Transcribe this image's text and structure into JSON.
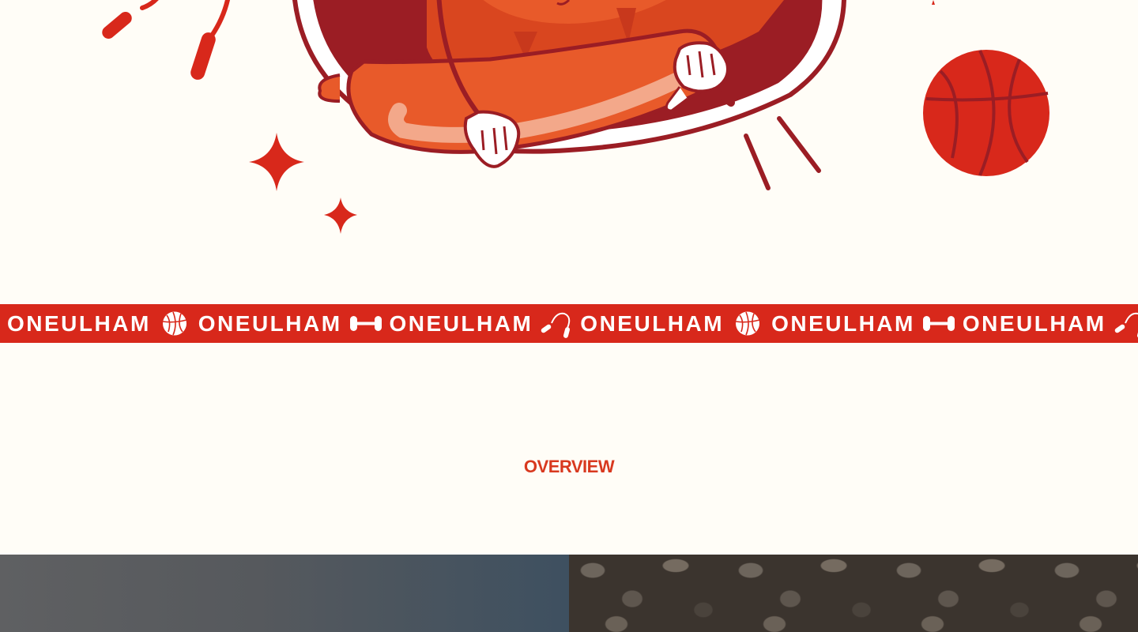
{
  "hero": {
    "illustration": "hotdog-mascot-illustration",
    "decorations": [
      "jump-rope-icon",
      "sparkle-icon",
      "basketball-icon"
    ]
  },
  "marquee": {
    "items": [
      {
        "word": "ONEULHAM",
        "icon": "basketball-icon"
      },
      {
        "word": "ONEULHAM",
        "icon": "dumbbell-icon"
      },
      {
        "word": "ONEULHAM",
        "icon": "jump-rope-icon"
      },
      {
        "word": "ONEULHAM",
        "icon": "basketball-icon"
      },
      {
        "word": "ONEULHAM",
        "icon": "dumbbell-icon"
      },
      {
        "word": "ONEULHAM",
        "icon": "jump-rope-icon"
      }
    ],
    "color": "#d8281b"
  },
  "overview": {
    "label": "OVERVIEW",
    "color": "#d8391f"
  },
  "colors": {
    "background": "#fffdf7",
    "brand_red": "#d8281b"
  }
}
